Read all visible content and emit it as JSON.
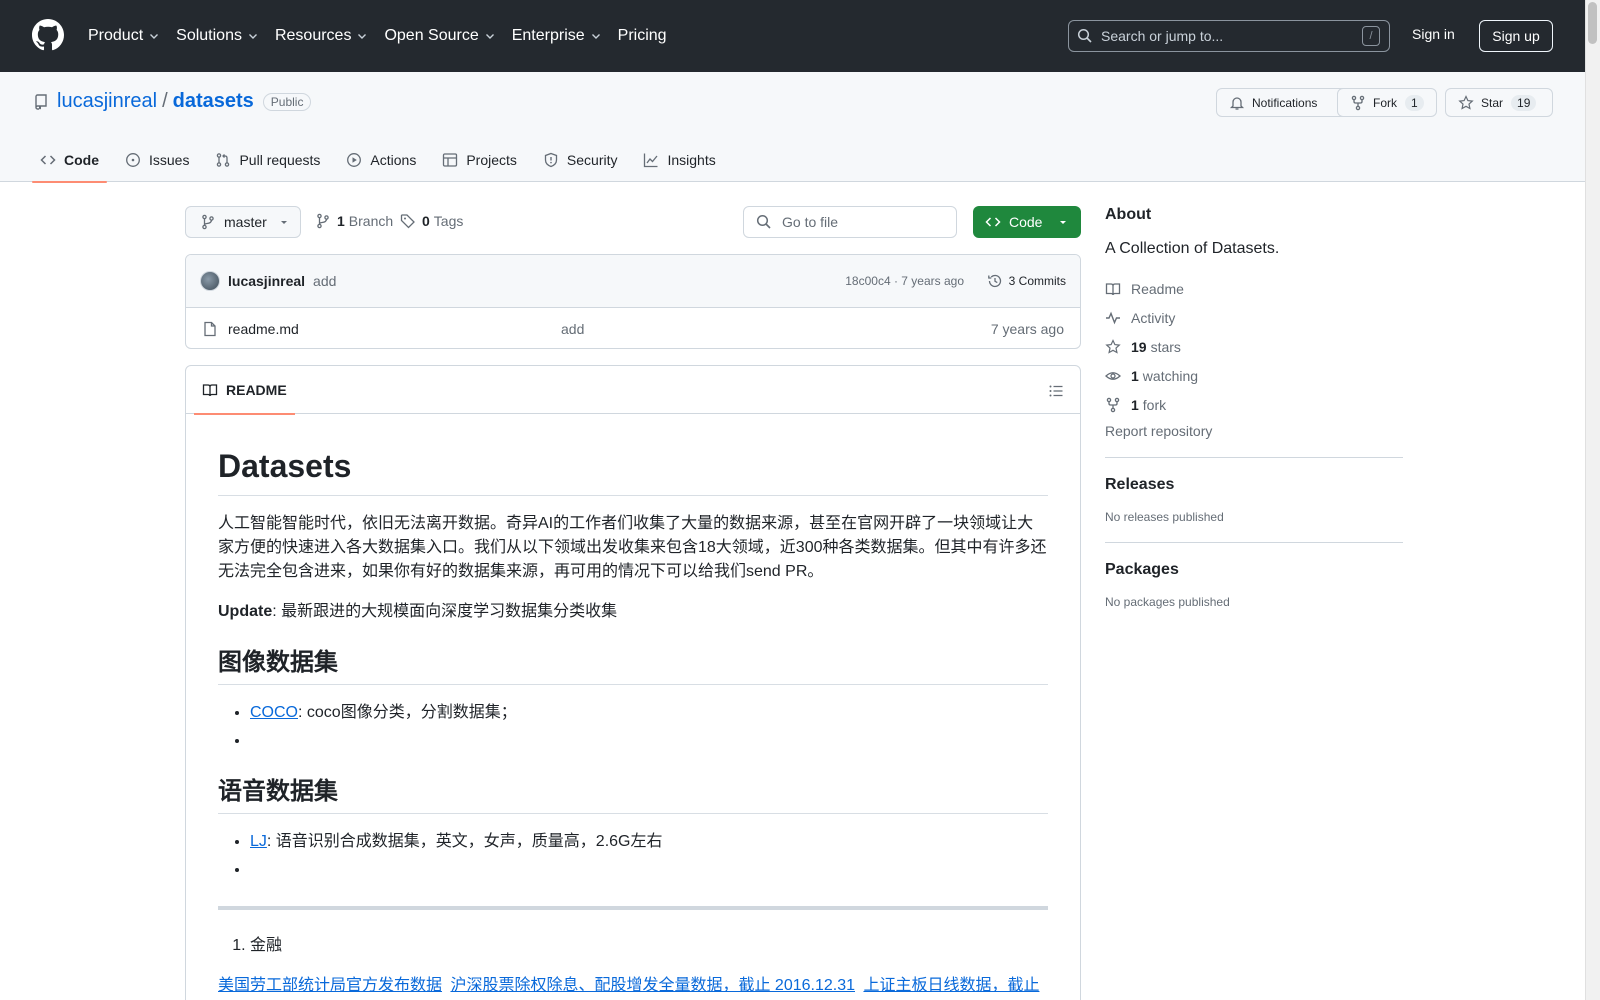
{
  "nav": {
    "items": [
      {
        "label": "Product",
        "dropdown": true
      },
      {
        "label": "Solutions",
        "dropdown": true
      },
      {
        "label": "Resources",
        "dropdown": true
      },
      {
        "label": "Open Source",
        "dropdown": true
      },
      {
        "label": "Enterprise",
        "dropdown": true
      },
      {
        "label": "Pricing",
        "dropdown": false
      }
    ],
    "search_placeholder": "Search or jump to...",
    "search_shortcut": "/",
    "sign_in": "Sign in",
    "sign_up": "Sign up"
  },
  "repo": {
    "owner": "lucasjinreal",
    "separator": "/",
    "name": "datasets",
    "visibility": "Public",
    "notifications_label": "Notifications",
    "fork_label": "Fork",
    "fork_count": "1",
    "star_label": "Star",
    "star_count": "19",
    "tabs": [
      {
        "label": "Code",
        "icon": "code-icon",
        "active": true
      },
      {
        "label": "Issues",
        "icon": "issue-opened-icon",
        "active": false
      },
      {
        "label": "Pull requests",
        "icon": "git-pull-request-icon",
        "active": false
      },
      {
        "label": "Actions",
        "icon": "play-icon",
        "active": false
      },
      {
        "label": "Projects",
        "icon": "table-icon",
        "active": false
      },
      {
        "label": "Security",
        "icon": "shield-icon",
        "active": false
      },
      {
        "label": "Insights",
        "icon": "graph-icon",
        "active": false
      }
    ]
  },
  "toolbar": {
    "branch": "master",
    "branch_count": "1",
    "branch_label": "Branch",
    "tag_count": "0",
    "tag_label": "Tags",
    "go_to_file": "Go to file",
    "code_button": "Code"
  },
  "commit": {
    "author": "lucasjinreal",
    "message": "add",
    "hash_time": "18c00c4 · 7 years ago",
    "commits_label": "3 Commits"
  },
  "files": [
    {
      "name": "readme.md",
      "message": "add",
      "date": "7 years ago"
    }
  ],
  "readme": {
    "tab_label": "README",
    "title": "Datasets",
    "intro": "人工智能智能时代，依旧无法离开数据。奇异AI的工作者们收集了大量的数据来源，甚至在官网开辟了一块领域让大家方便的快速进入各大数据集入口。我们从以下领域出发收集来包含18大领域，近300种各类数据集。但其中有许多还无法完全包含进来，如果你有好的数据集来源，再可用的情况下可以给我们send PR。",
    "update_bold": "Update",
    "update_text": ": 最新跟进的大规模面向深度学习数据集分类收集",
    "section_image": "图像数据集",
    "coco_link": "COCO",
    "coco_text": ": coco图像分类，分割数据集；",
    "section_audio": "语音数据集",
    "lj_link": "LJ",
    "lj_text": ": 语音识别合成数据集，英文，女声，质量高，2.6G左右",
    "ordered_item": "金融",
    "finance_links": [
      "美国劳工部统计局官方发布数据",
      "沪深股票除权除息、配股增发全量数据，截止 2016.12.31",
      "上证主板日线数据，截止"
    ]
  },
  "about": {
    "heading": "About",
    "description": "A Collection of Datasets.",
    "readme": "Readme",
    "activity": "Activity",
    "stars_count": "19",
    "stars_label": "stars",
    "watching_count": "1",
    "watching_label": "watching",
    "forks_count": "1",
    "forks_label": "fork",
    "report": "Report repository"
  },
  "releases": {
    "heading": "Releases",
    "empty": "No releases published"
  },
  "packages": {
    "heading": "Packages",
    "empty": "No packages published"
  },
  "colors": {
    "header_bg": "#24292f",
    "link": "#0969da",
    "green_button": "#1f883d",
    "tab_underline": "#fd8c73",
    "border": "#d0d7de"
  }
}
